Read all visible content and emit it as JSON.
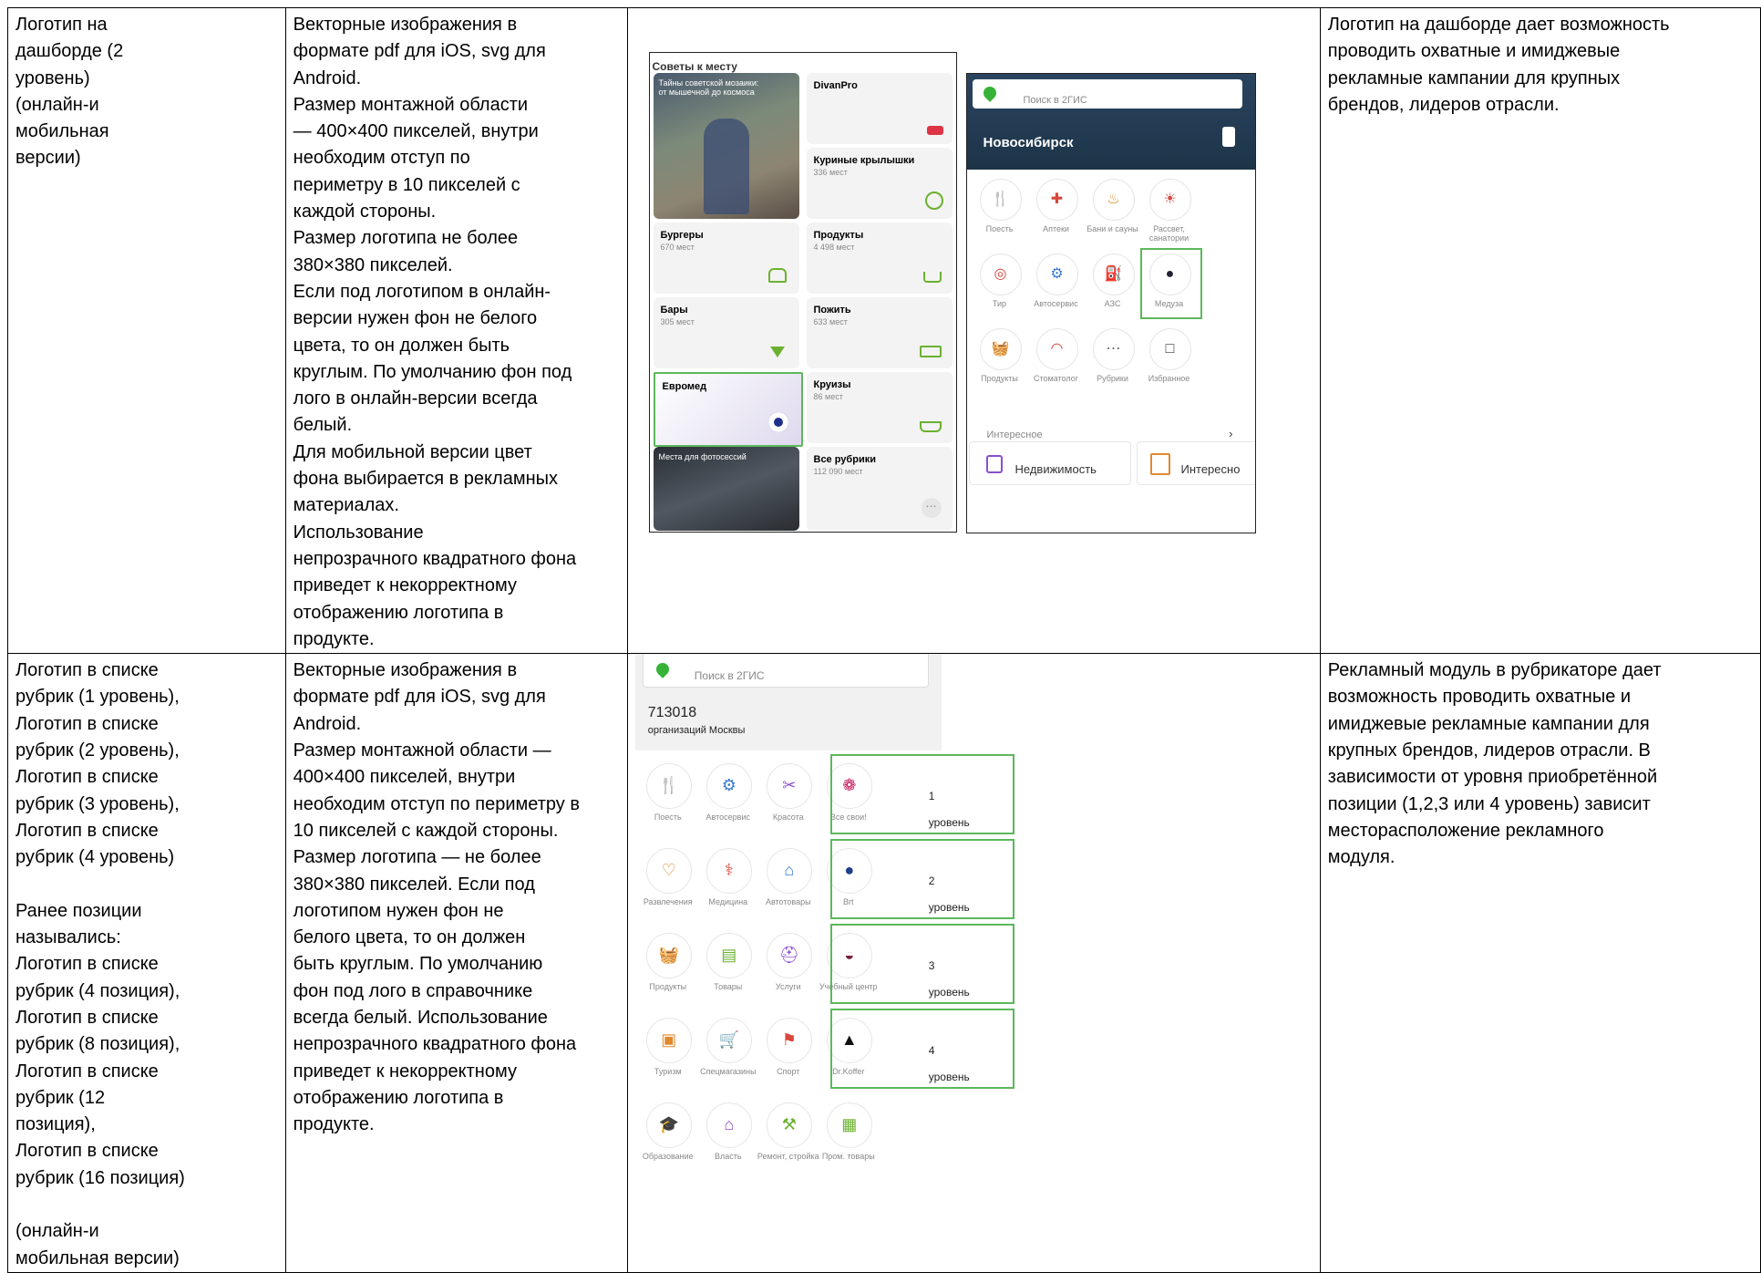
{
  "rows": [
    {
      "col1": "Логотип на\nдашборде (2\nуровень)\n(онлайн-и\nмобильная\nверсии)",
      "col2": "Векторные изображения в\nформате pdf для iOS, svg для\nAndroid.\nРазмер монтажной области\n— 400×400 пикселей, внутри\nнеобходим отступ по\nпериметру в 10 пикселей с\nкаждой стороны.\nРазмер логотипа не более\n380×380 пикселей.\nЕсли под логотипом в онлайн-\nверсии нужен фон не белого\nцвета, то он должен быть\nкруглым. По умолчанию фон под\nлого в онлайн-версии всегда\nбелый.\nДля мобильной версии цвет\nфона выбирается в рекламных\nматериалах.\nИспользование\nнепрозрачного квадратного фона\nприведет к некорректному\nотображению логотипа в\nпродукте.",
      "col4": "Логотип на дашборде дает возможность\nпроводить охватные и имиджевые\nрекламные кампании для крупных\nбрендов, лидеров отрасли."
    },
    {
      "col1": "Логотип в списке\nрубрик (1 уровень),\nЛоготип в списке\nрубрик (2 уровень),\nЛоготип в списке\nрубрик (3 уровень),\nЛоготип в списке\nрубрик (4 уровень)\n\nРанее позиции\nназывались:\nЛоготип в списке\nрубрик (4 позиция),\nЛоготип в списке\nрубрик (8 позиция),\nЛоготип в списке\nрубрик (12\nпозиция),\nЛоготип в списке\nрубрик (16 позиция)\n\n(онлайн-и\nмобильная версии)",
      "col2": "Векторные изображения в\nформате pdf для iOS, svg для\nAndroid.\nРазмер монтажной области —\n400×400 пикселей, внутри\nнеобходим отступ по периметру в\n10 пикселей с каждой стороны.\nРазмер логотипа — не более\n380×380 пикселей. Если под\nлоготипом нужен фон не\nбелого цвета, то он должен\nбыть круглым. По умолчанию\nфон под лого в справочнике\nвсегда белый. Использование\nнепрозрачного квадратного фона\nприведет к некорректному\nотображению логотипа в\nпродукте.",
      "col4": "Рекламный модуль в рубрикаторе дает\nвозможность проводить охватные и\nимиджевые рекламные кампании для\nкрупных брендов, лидеров отрасли. В\nзависимости от уровня приобретённой\nпозиции (1,2,3 или 4 уровень) зависит\nместорасположение рекламного\nмодуля."
    }
  ],
  "shot_a": {
    "header": "Советы к месту",
    "hero": "Тайны советской мозаики: от мышечной до космоса",
    "cards": [
      {
        "title": "DivanPro",
        "count": ""
      },
      {
        "title": "Куриные крылышки",
        "count": "336 мест"
      },
      {
        "title": "Бургеры",
        "count": "670 мест"
      },
      {
        "title": "Продукты",
        "count": "4 498 мест"
      },
      {
        "title": "Бары",
        "count": "305 мест"
      },
      {
        "title": "Пожить",
        "count": "633 мест"
      },
      {
        "title": "Евромед",
        "count": ""
      },
      {
        "title": "Круизы",
        "count": "86 мест"
      },
      {
        "title": "Места для фотосессий",
        "count": ""
      },
      {
        "title": "Все рубрики",
        "count": "112 090 мест"
      }
    ]
  },
  "shot_b": {
    "search": "Поиск в 2ГИС",
    "city": "Новосибирск",
    "items": [
      "Поесть",
      "Аптеки",
      "Бани и сауны",
      "Рассвет, санатории",
      "Тир",
      "Автосервис",
      "АЗС",
      "Медуза",
      "Продукты",
      "Стоматолог",
      "Рубрики",
      "Избранное"
    ],
    "section": "Интересное",
    "chips": [
      "Недвижимость",
      "Интересно"
    ]
  },
  "shot_c": {
    "search": "Поиск в 2ГИС",
    "count": "713018",
    "count_sub": "организаций Москвы",
    "grid": [
      [
        "Поесть",
        "Автосервис",
        "Красота",
        "Все свои!"
      ],
      [
        "Развлечения",
        "Медицина",
        "Автотовары",
        "Brt"
      ],
      [
        "Продукты",
        "Товары",
        "Услуги",
        "Учебный центр"
      ],
      [
        "Туризм",
        "Спецмагазины",
        "Спорт",
        "Dr.Koffer"
      ],
      [
        "Образование",
        "Власть",
        "Ремонт, стройка",
        "Пром. товары"
      ]
    ],
    "levels": [
      "1 уровень",
      "2 уровень",
      "3 уровень",
      "4 уровень"
    ]
  },
  "colors": {
    "highlight": "#5cb85c",
    "orange": "#e08a2e",
    "red": "#d9463b",
    "blue": "#3a7bd5",
    "purple": "#8a4fd0",
    "green": "#6bb12f",
    "city_header": "#1d3448"
  }
}
